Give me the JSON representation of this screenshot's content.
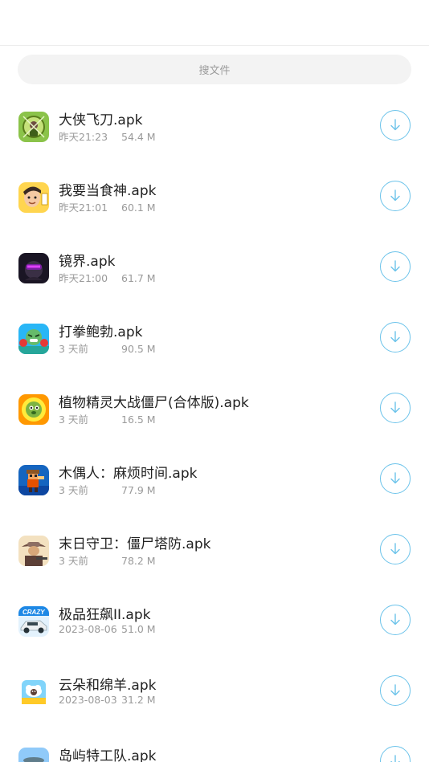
{
  "search": {
    "placeholder": "搜文件"
  },
  "colors": {
    "accent": "#6cc3ea",
    "text": "#222222",
    "subtext": "#9a9a9a"
  },
  "files": [
    {
      "name": "大侠飞刀.apk",
      "date": "昨天21:23",
      "size": "54.4 M",
      "icon": "game-icon-green"
    },
    {
      "name": "我要当食神.apk",
      "date": "昨天21:01",
      "size": "60.1 M",
      "icon": "game-icon-yellow"
    },
    {
      "name": "镜界.apk",
      "date": "昨天21:00",
      "size": "61.7 M",
      "icon": "game-icon-dark"
    },
    {
      "name": "打拳鲍勃.apk",
      "date": "3 天前",
      "size": "90.5 M",
      "icon": "game-icon-blue"
    },
    {
      "name": "植物精灵大战僵尸(合体版).apk",
      "date": "3 天前",
      "size": "16.5 M",
      "icon": "game-icon-orange"
    },
    {
      "name": "木偶人：麻烦时间.apk",
      "date": "3 天前",
      "size": "77.9 M",
      "icon": "game-icon-pixel"
    },
    {
      "name": "末日守卫：僵尸塔防.apk",
      "date": "3 天前",
      "size": "78.2 M",
      "icon": "game-icon-cowboy"
    },
    {
      "name": "极品狂飙II.apk",
      "date": "2023-08-06",
      "size": "51.0 M",
      "icon": "game-icon-car"
    },
    {
      "name": "云朵和绵羊.apk",
      "date": "2023-08-03",
      "size": "31.2 M",
      "icon": "game-icon-sheep"
    },
    {
      "name": "岛屿特工队.apk",
      "date": "",
      "size": "",
      "icon": "game-icon-island"
    }
  ]
}
